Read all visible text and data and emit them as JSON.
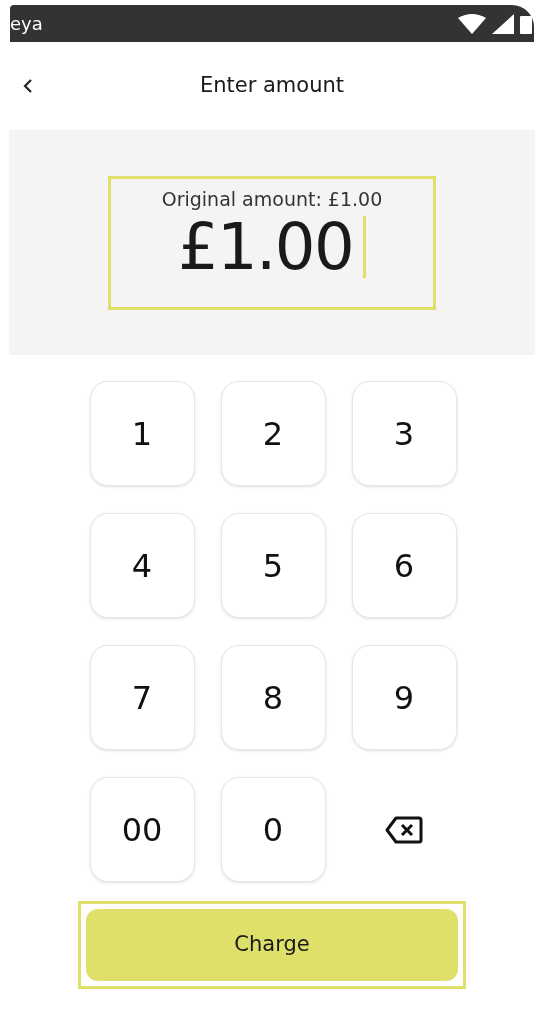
{
  "status_bar": {
    "carrier": "eya"
  },
  "header": {
    "title": "Enter amount"
  },
  "amount": {
    "original": "Original amount: £1.00",
    "value": "£1.00"
  },
  "keypad": [
    {
      "kind": "digit",
      "label": "1"
    },
    {
      "kind": "digit",
      "label": "2"
    },
    {
      "kind": "digit",
      "label": "3"
    },
    {
      "kind": "digit",
      "label": "4"
    },
    {
      "kind": "digit",
      "label": "5"
    },
    {
      "kind": "digit",
      "label": "6"
    },
    {
      "kind": "digit",
      "label": "7"
    },
    {
      "kind": "digit",
      "label": "8"
    },
    {
      "kind": "digit",
      "label": "9"
    },
    {
      "kind": "digit",
      "label": "00"
    },
    {
      "kind": "digit",
      "label": "0"
    },
    {
      "kind": "backspace"
    }
  ],
  "charge_button": {
    "label": "Charge"
  }
}
